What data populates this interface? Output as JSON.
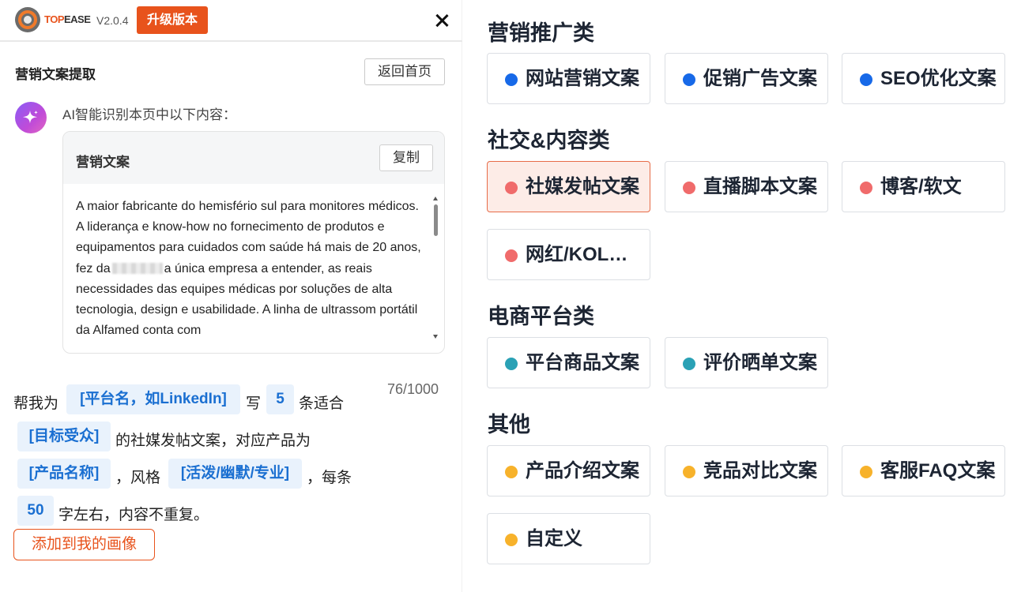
{
  "colors": {
    "accent": "#e8531c",
    "chip_bg": "#e9f2fc",
    "chip_text": "#1a6fd1",
    "dot_marketing": "#1769e8",
    "dot_social": "#f06b6b",
    "dot_ecommerce": "#2aa1b5",
    "dot_other": "#f7b22b",
    "selected_bg": "#fdece7",
    "selected_border": "#e76c48"
  },
  "header": {
    "brand_part1": "TOP",
    "brand_part2": "EASE",
    "version": "V2.0.4",
    "upgrade_label": "升级版本",
    "close_icon": "close-icon"
  },
  "panel": {
    "title": "营销文案提取",
    "home_label": "返回首页",
    "ai_icon": "sparkle-icon",
    "ai_intro": "AI智能识别本页中以下内容：",
    "card_title": "营销文案",
    "copy_label": "复制",
    "text_before_blur": "A maior fabricante do hemisfério sul para monitores médicos. A liderança e know-how no fornecimento de produtos e equipamentos para cuidados com saúde há mais de 20 anos, fez da",
    "text_after_blur": "a única empresa a entender, as reais necessidades das equipes médicas por soluções de alta tecnologia, design e usabilidade. A linha de ultrassom portátil da Alfamed conta com"
  },
  "prompt": {
    "counter": "76/1000",
    "t1": "帮我为",
    "chip_platform": "[平台名，如LinkedIn]",
    "t2": "写",
    "chip_count": "5",
    "t3": "条适合",
    "chip_audience": "[目标受众]",
    "t4": "的社媒发帖文案，对应产品为",
    "chip_product": "[产品名称]",
    "t5": "，风格",
    "chip_style": "[活泼/幽默/专业]",
    "t6": "，每条",
    "chip_words": "50",
    "t7": "字左右，内容不重复。",
    "add_label": "添加到我的画像"
  },
  "categories": [
    {
      "heading": "营销推广类",
      "items": [
        {
          "label": "网站营销文案"
        },
        {
          "label": "促销广告文案"
        },
        {
          "label": "SEO优化文案"
        }
      ]
    },
    {
      "heading": "社交&内容类",
      "items": [
        {
          "label": "社媒发帖文案",
          "selected": true
        },
        {
          "label": "直播脚本文案"
        },
        {
          "label": "博客/软文"
        },
        {
          "label": "网红/KOL文案"
        }
      ]
    },
    {
      "heading": "电商平台类",
      "items": [
        {
          "label": "平台商品文案"
        },
        {
          "label": "评价晒单文案"
        }
      ]
    },
    {
      "heading": "其他",
      "items": [
        {
          "label": "产品介绍文案"
        },
        {
          "label": "竞品对比文案"
        },
        {
          "label": "客服FAQ文案"
        },
        {
          "label": "自定义"
        }
      ]
    }
  ]
}
